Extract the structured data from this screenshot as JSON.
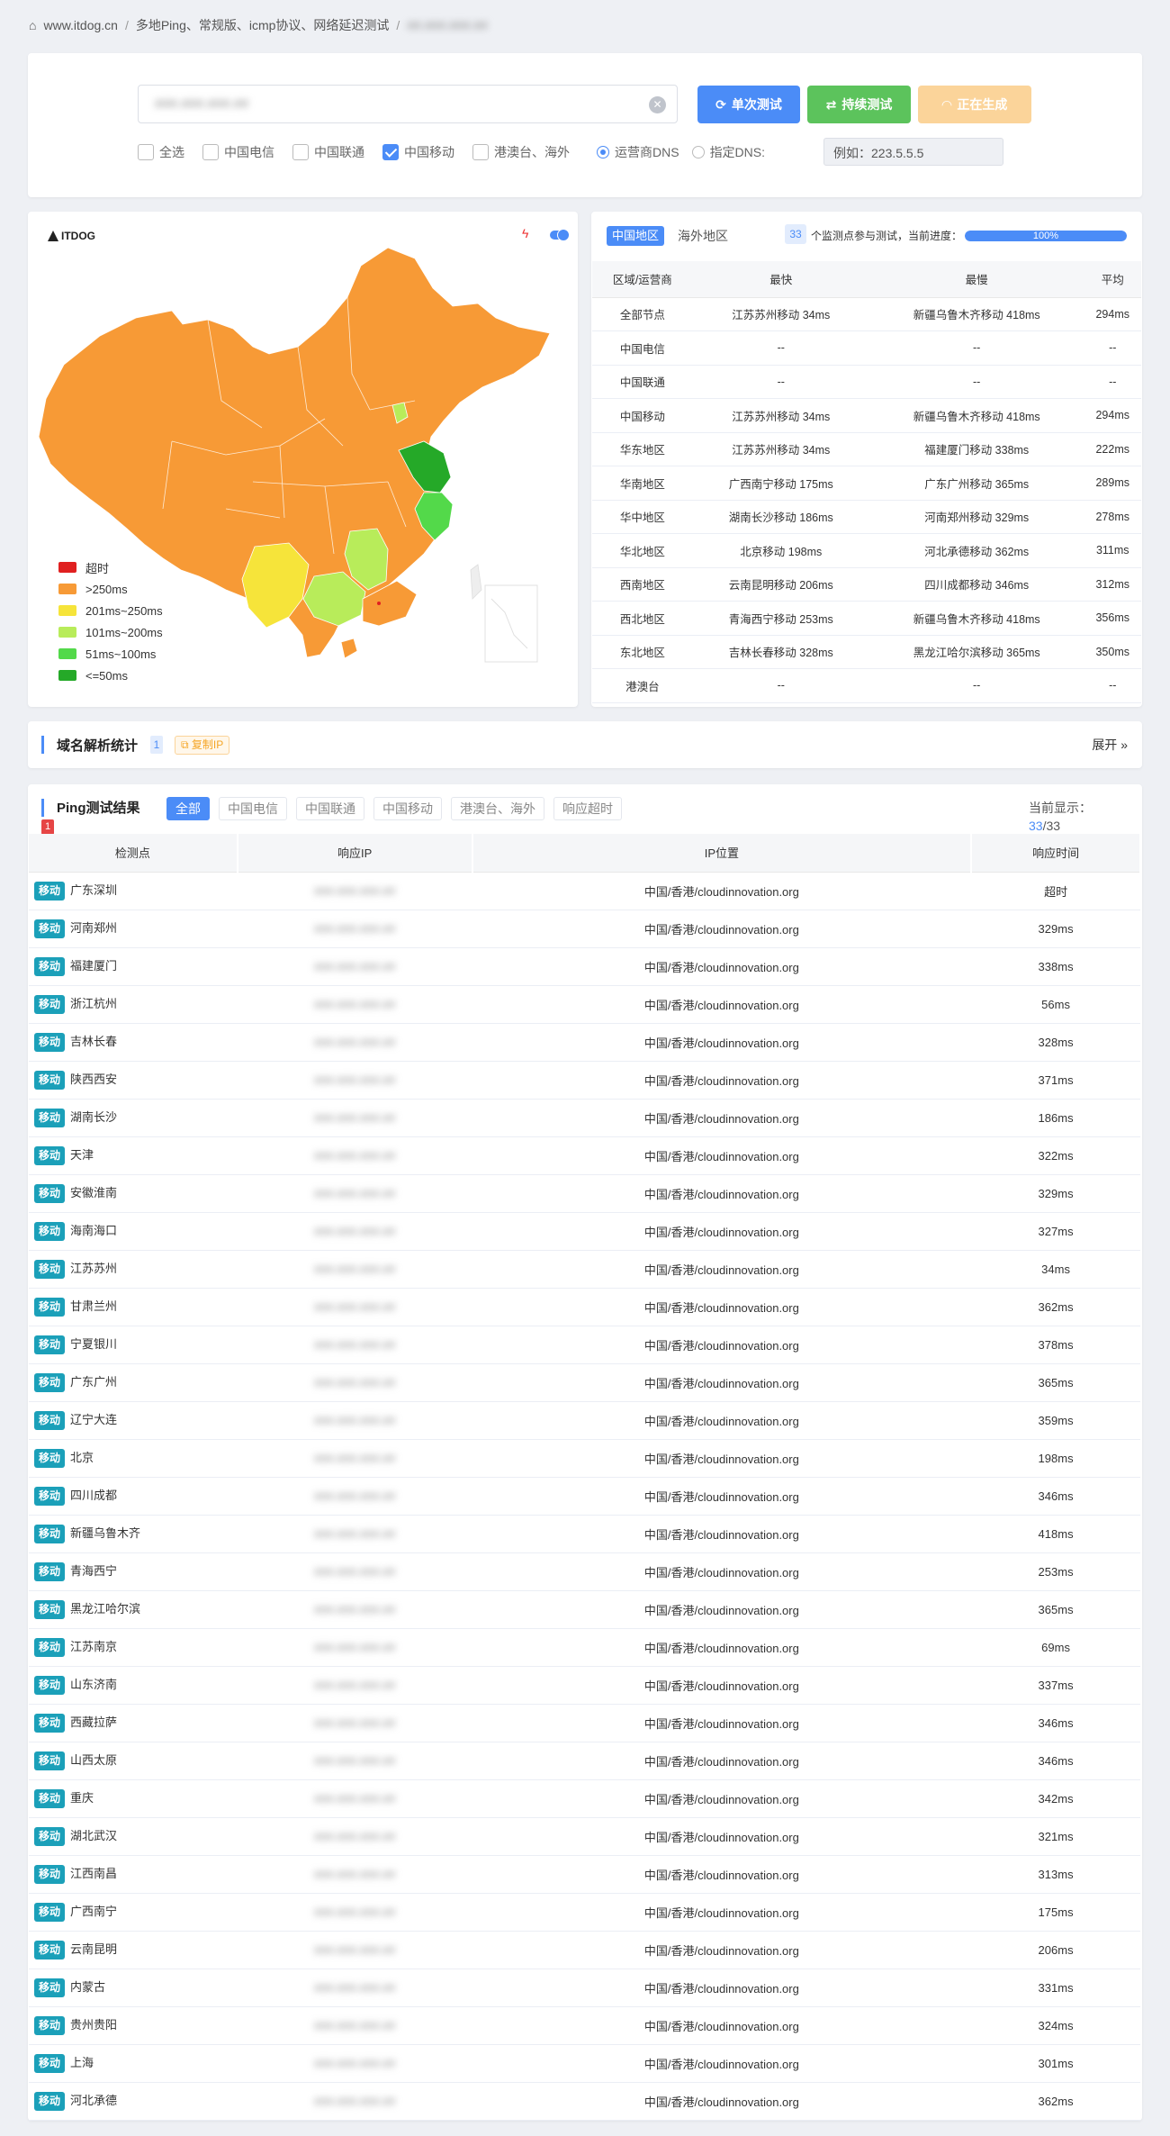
{
  "breadcrumb": {
    "site": "www.itdog.cn",
    "page": "多地Ping、常规版、icmp协议、网络延迟测试",
    "target": "##.###.###.##"
  },
  "search": {
    "value": "###.###.###.##",
    "btn_single": "单次测试",
    "btn_continuous": "持续测试",
    "btn_generating": "正在生成",
    "options": [
      {
        "label": "全选",
        "checked": false
      },
      {
        "label": "中国电信",
        "checked": false
      },
      {
        "label": "中国联通",
        "checked": false
      },
      {
        "label": "中国移动",
        "checked": true
      },
      {
        "label": "港澳台、海外",
        "checked": false
      }
    ],
    "dns_isp": "运营商DNS",
    "dns_custom": "指定DNS:",
    "dns_placeholder": "例如：223.5.5.5"
  },
  "map": {
    "logo": "ITDOG",
    "legend": [
      {
        "label": "超时",
        "color": "#e02020"
      },
      {
        "label": ">250ms",
        "color": "#f79a36"
      },
      {
        "label": "201ms~250ms",
        "color": "#f6e43a"
      },
      {
        "label": "101ms~200ms",
        "color": "#b8ec5a"
      },
      {
        "label": "51ms~100ms",
        "color": "#53d94a"
      },
      {
        "label": "<=50ms",
        "color": "#25a928"
      }
    ]
  },
  "stats": {
    "tab_china": "中国地区",
    "tab_overseas": "海外地区",
    "node_count": "33",
    "progress_text": "个监测点参与测试，当前进度：",
    "progress": "100%",
    "progress_value": 100,
    "headers": [
      "区域/运营商",
      "最快",
      "最慢",
      "平均"
    ],
    "rows": [
      [
        "全部节点",
        "江苏苏州移动 34ms",
        "新疆乌鲁木齐移动 418ms",
        "294ms"
      ],
      [
        "中国电信",
        "--",
        "--",
        "--"
      ],
      [
        "中国联通",
        "--",
        "--",
        "--"
      ],
      [
        "中国移动",
        "江苏苏州移动 34ms",
        "新疆乌鲁木齐移动 418ms",
        "294ms"
      ],
      [
        "华东地区",
        "江苏苏州移动 34ms",
        "福建厦门移动 338ms",
        "222ms"
      ],
      [
        "华南地区",
        "广西南宁移动 175ms",
        "广东广州移动 365ms",
        "289ms"
      ],
      [
        "华中地区",
        "湖南长沙移动 186ms",
        "河南郑州移动 329ms",
        "278ms"
      ],
      [
        "华北地区",
        "北京移动 198ms",
        "河北承德移动 362ms",
        "311ms"
      ],
      [
        "西南地区",
        "云南昆明移动 206ms",
        "四川成都移动 346ms",
        "312ms"
      ],
      [
        "西北地区",
        "青海西宁移动 253ms",
        "新疆乌鲁木齐移动 418ms",
        "356ms"
      ],
      [
        "东北地区",
        "吉林长春移动 328ms",
        "黑龙江哈尔滨移动 365ms",
        "350ms"
      ],
      [
        "港澳台",
        "--",
        "--",
        "--"
      ]
    ]
  },
  "domain": {
    "title": "域名解析统计",
    "count": "1",
    "copy": "复制IP",
    "expand": "展开"
  },
  "ping": {
    "title": "Ping测试结果",
    "badge": "1",
    "tabs": [
      "全部",
      "中国电信",
      "中国联通",
      "中国移动",
      "港澳台、海外",
      "响应超时"
    ],
    "current_label": "当前显示：",
    "current_num": "33",
    "current_total": "/33",
    "headers": [
      "检测点",
      "响应IP",
      "IP位置",
      "响应时间"
    ],
    "tag": "移动",
    "ip": "###.###.###.##",
    "location": "中国/香港/cloudinnovation.org",
    "rows": [
      {
        "name": "广东深圳",
        "time": "超时"
      },
      {
        "name": "河南郑州",
        "time": "329ms"
      },
      {
        "name": "福建厦门",
        "time": "338ms"
      },
      {
        "name": "浙江杭州",
        "time": "56ms"
      },
      {
        "name": "吉林长春",
        "time": "328ms"
      },
      {
        "name": "陕西西安",
        "time": "371ms"
      },
      {
        "name": "湖南长沙",
        "time": "186ms"
      },
      {
        "name": "天津",
        "time": "322ms"
      },
      {
        "name": "安徽淮南",
        "time": "329ms"
      },
      {
        "name": "海南海口",
        "time": "327ms"
      },
      {
        "name": "江苏苏州",
        "time": "34ms"
      },
      {
        "name": "甘肃兰州",
        "time": "362ms"
      },
      {
        "name": "宁夏银川",
        "time": "378ms"
      },
      {
        "name": "广东广州",
        "time": "365ms"
      },
      {
        "name": "辽宁大连",
        "time": "359ms"
      },
      {
        "name": "北京",
        "time": "198ms"
      },
      {
        "name": "四川成都",
        "time": "346ms"
      },
      {
        "name": "新疆乌鲁木齐",
        "time": "418ms"
      },
      {
        "name": "青海西宁",
        "time": "253ms"
      },
      {
        "name": "黑龙江哈尔滨",
        "time": "365ms"
      },
      {
        "name": "江苏南京",
        "time": "69ms"
      },
      {
        "name": "山东济南",
        "time": "337ms"
      },
      {
        "name": "西藏拉萨",
        "time": "346ms"
      },
      {
        "name": "山西太原",
        "time": "346ms"
      },
      {
        "name": "重庆",
        "time": "342ms"
      },
      {
        "name": "湖北武汉",
        "time": "321ms"
      },
      {
        "name": "江西南昌",
        "time": "313ms"
      },
      {
        "name": "广西南宁",
        "time": "175ms"
      },
      {
        "name": "云南昆明",
        "time": "206ms"
      },
      {
        "name": "内蒙古",
        "time": "331ms"
      },
      {
        "name": "贵州贵阳",
        "time": "324ms"
      },
      {
        "name": "上海",
        "time": "301ms"
      },
      {
        "name": "河北承德",
        "time": "362ms"
      }
    ]
  }
}
